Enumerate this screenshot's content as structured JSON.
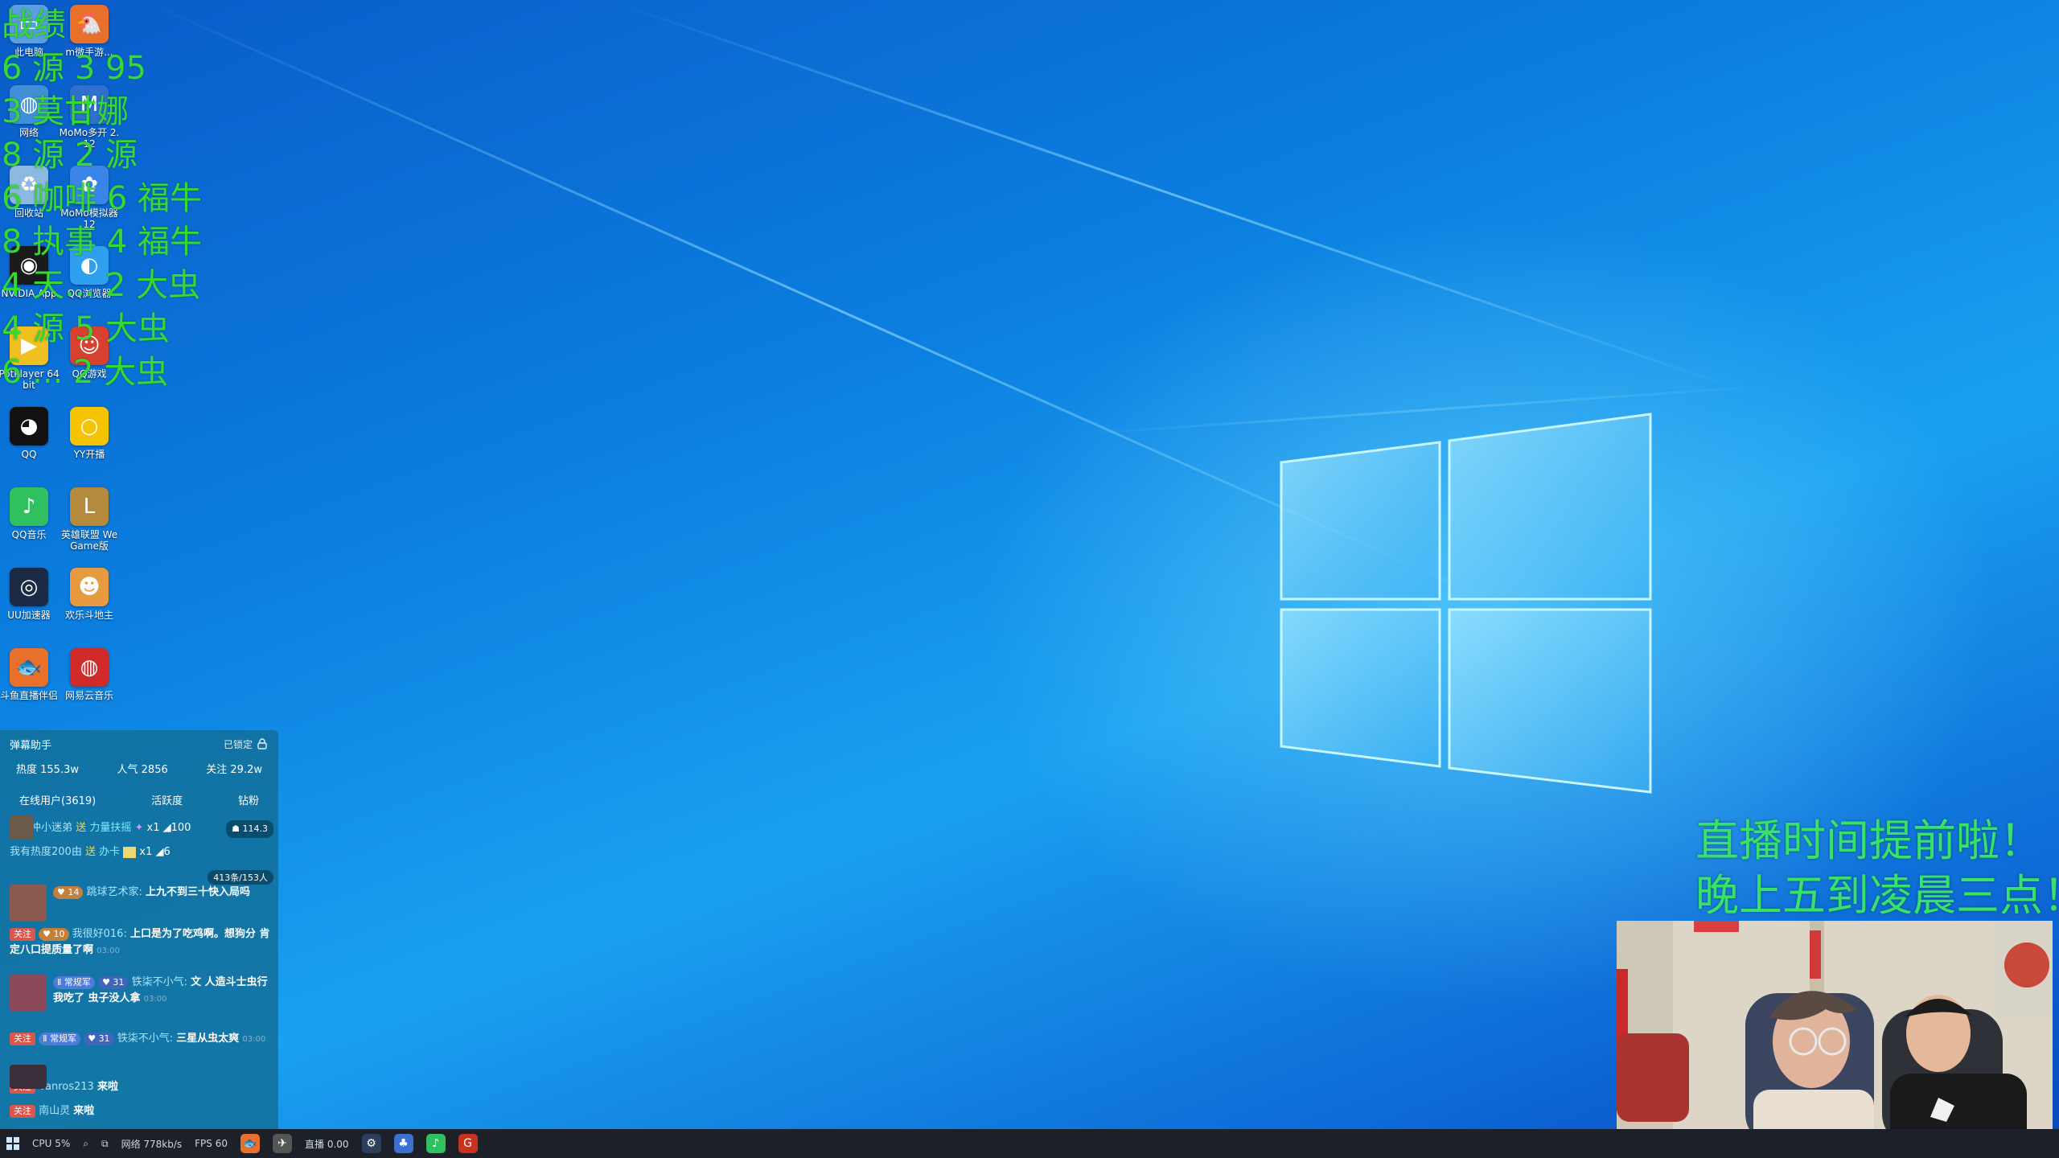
{
  "stats_overlay": {
    "lines": [
      "战绩",
      "6 源 3 95",
      "3 莫甘娜",
      "8 源 2 源",
      "6 咖啡 6 福牛",
      "8 执事 4 福牛",
      "4 天... 2 大虫",
      "4 源 5 大虫",
      "6 ... 2 大虫"
    ]
  },
  "desktop_icons": [
    {
      "label": "此电脑",
      "icon": "computer-icon",
      "color": "#5aa0e0"
    },
    {
      "label": "m微手游...",
      "icon": "chicken-icon",
      "color": "#e8702a"
    },
    {
      "label": "网络",
      "icon": "network-icon",
      "color": "#3e8fd6"
    },
    {
      "label": "MoMo多开 2.12",
      "icon": "momo-icon",
      "color": "#2f6fd0"
    },
    {
      "label": "回收站",
      "icon": "recycle-bin-icon",
      "color": "#8cb9e0"
    },
    {
      "label": "MoMo模拟器12",
      "icon": "momo-emulator-icon",
      "color": "#3a86e8"
    },
    {
      "label": "NVIDIA App",
      "icon": "nvidia-icon",
      "color": "#1a1a1a"
    },
    {
      "label": "QQ浏览器",
      "icon": "qq-browser-icon",
      "color": "#2da0f0"
    },
    {
      "label": "PotPlayer 64 bit",
      "icon": "potplayer-icon",
      "color": "#f0c020"
    },
    {
      "label": "QQ游戏",
      "icon": "qq-game-icon",
      "color": "#d84030"
    },
    {
      "label": "QQ",
      "icon": "qq-penguin-icon",
      "color": "#111111"
    },
    {
      "label": "YY开播",
      "icon": "yy-icon",
      "color": "#f4c400"
    },
    {
      "label": "QQ音乐",
      "icon": "qq-music-icon",
      "color": "#30c060"
    },
    {
      "label": "英雄联盟 WeGame版",
      "icon": "league-icon",
      "color": "#b48a3c"
    },
    {
      "label": "UU加速器",
      "icon": "uu-accelerator-icon",
      "color": "#1a2a44"
    },
    {
      "label": "欢乐斗地主",
      "icon": "doudizhu-icon",
      "color": "#e89a40"
    },
    {
      "label": "斗鱼直播伴侣",
      "icon": "douyu-icon",
      "color": "#e8702a"
    },
    {
      "label": "网易云音乐",
      "icon": "netease-music-icon",
      "color": "#d02a2a"
    }
  ],
  "chat": {
    "title": "弹幕助手",
    "lock_label": "已锁定",
    "heat": "热度 155.3w",
    "popularity": "人气 2856",
    "follows": "关注 29.2w",
    "tabs": [
      "在线用户(3619)",
      "活跃度",
      "钻粉"
    ],
    "gift_messages": [
      {
        "user": "冲冲冲小迷弟",
        "action": "送",
        "gift": "力量扶摇",
        "count": "x1",
        "value": "100",
        "pill": "114.3"
      },
      {
        "user": "我有热度200由",
        "action": "送",
        "gift": "办卡",
        "count": "x1",
        "value": "6",
        "pill": ""
      }
    ],
    "count_pill": "413条/153人",
    "messages": [
      {
        "level": "14",
        "user": "跳球艺术家:",
        "text": "上九不到三十快入局吗",
        "time": ""
      },
      {
        "follow": "关注",
        "level": "10",
        "user": "我很好016:",
        "text": "上口是为了吃鸡啊。想狗分 肯定八口提质量了啊",
        "time": "03:00"
      },
      {
        "fan": "常规军",
        "level": "31",
        "user": "铁柒不小气:",
        "text": "文 人造斗士虫行 我吃了 虫子没人拿",
        "time": "03:00"
      },
      {
        "follow": "关注",
        "fan": "常规军",
        "level": "31",
        "user": "铁柒不小气:",
        "text": "三星从虫太爽",
        "time": "03:00"
      },
      {
        "follow": "关注",
        "user": "Vanros213",
        "text": "来啦",
        "time": ""
      },
      {
        "follow": "关注",
        "user": "南山灵",
        "text": "来啦",
        "time": ""
      }
    ]
  },
  "taskbar": {
    "cpu": "CPU 5%",
    "network": "网络 778kb/s",
    "fps": "FPS 60",
    "extra": "直播 0.00"
  },
  "announcement": {
    "line1": "直播时间提前啦！",
    "line2": "晚上五到凌晨三点！"
  }
}
